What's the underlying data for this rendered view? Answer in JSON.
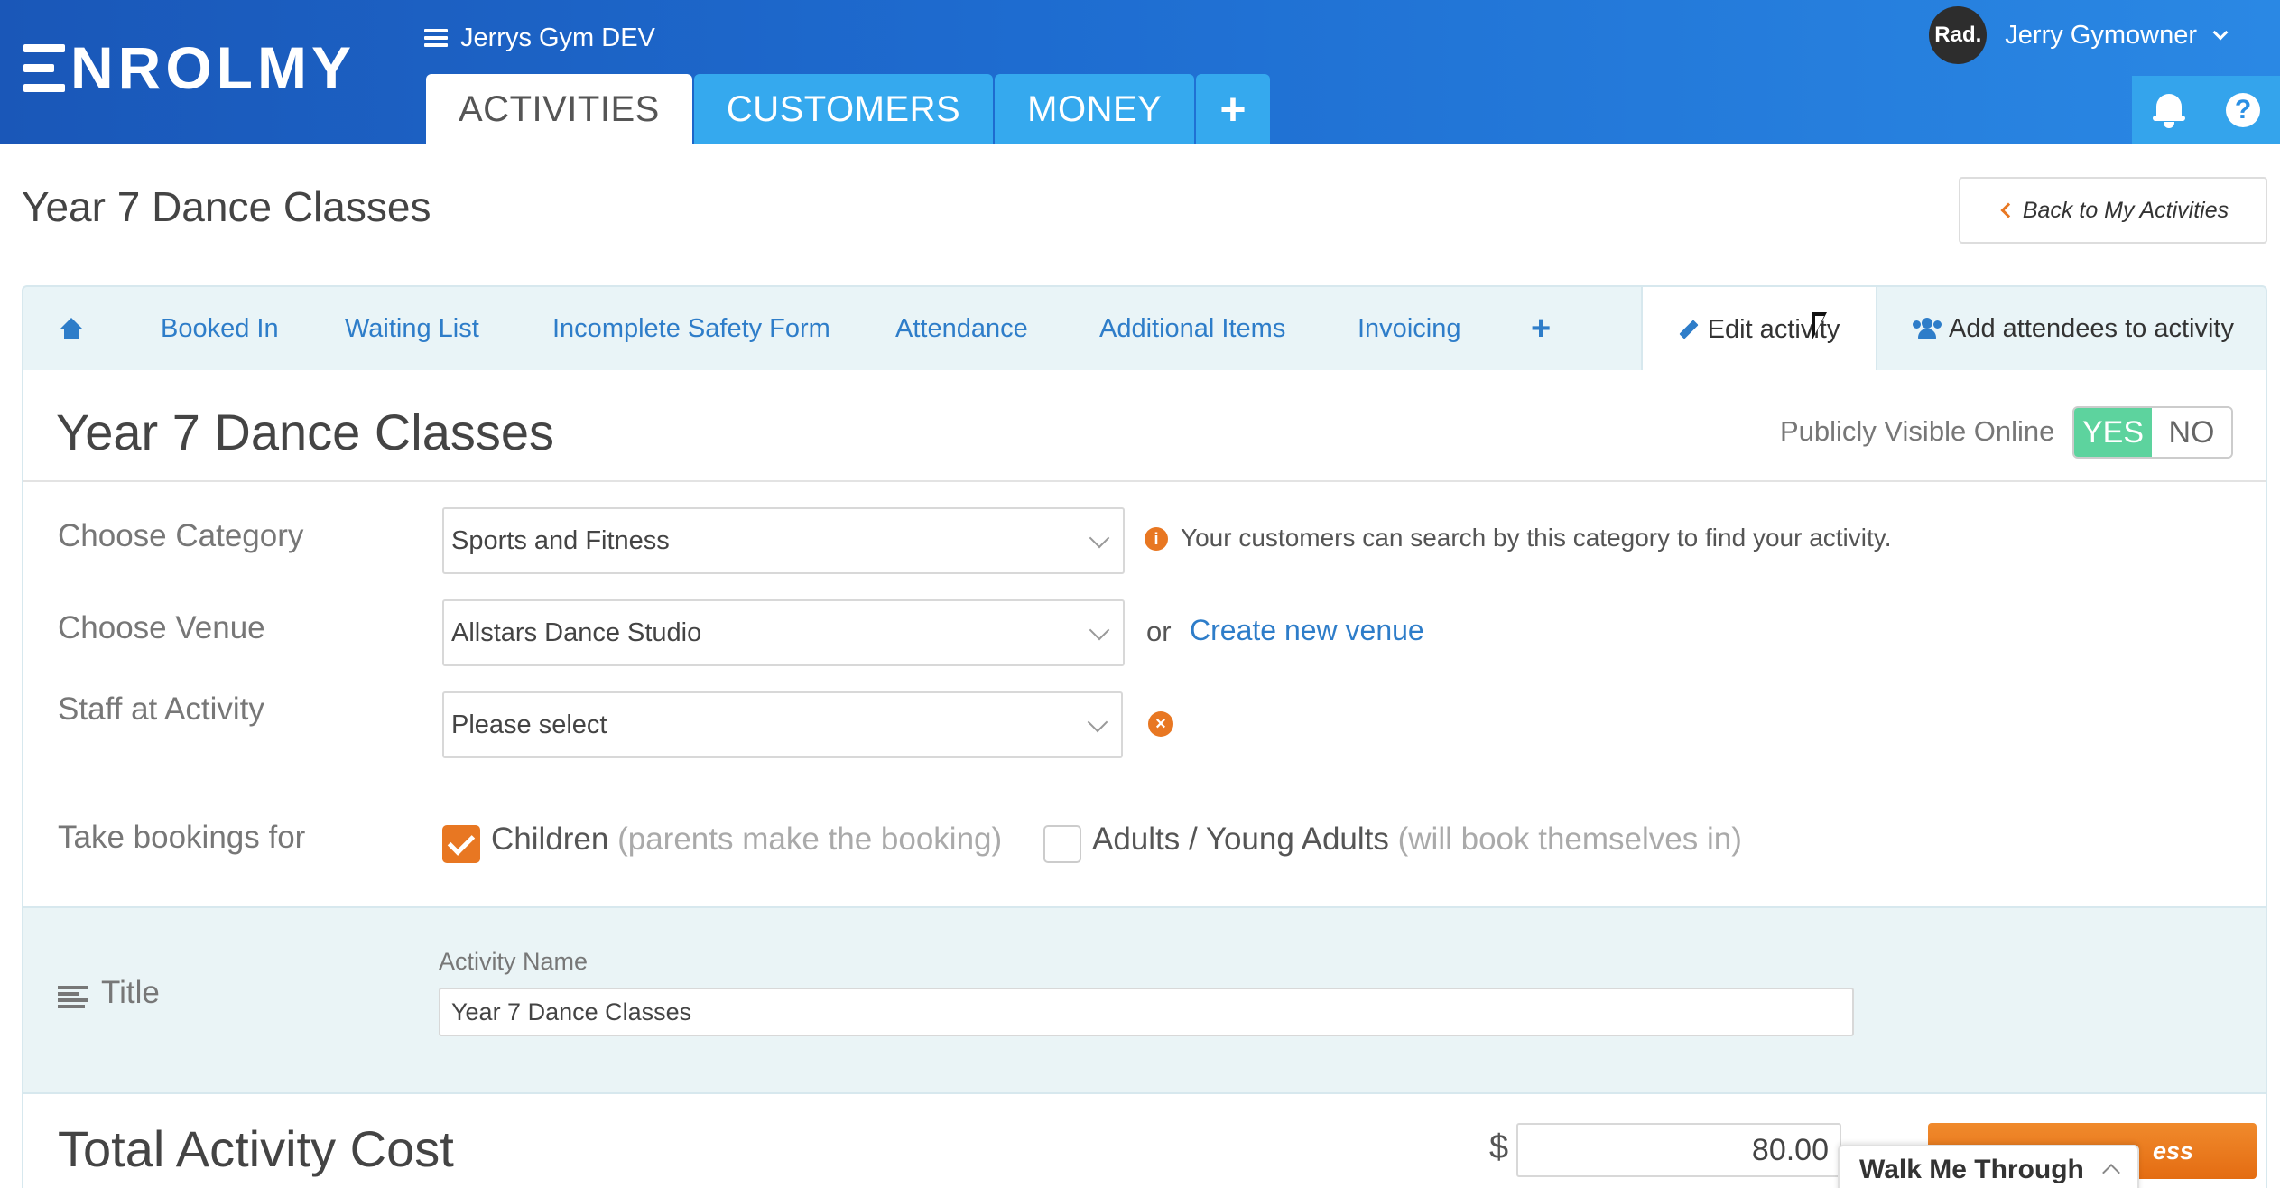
{
  "header": {
    "logo_text": "NROLMY",
    "org_name": "Jerrys Gym DEV",
    "main_tabs": [
      {
        "label": "ACTIVITIES",
        "active": true
      },
      {
        "label": "CUSTOMERS",
        "active": false
      },
      {
        "label": "MONEY",
        "active": false
      },
      {
        "label": "+",
        "active": false
      }
    ],
    "user": {
      "avatar_text": "Rad.",
      "name": "Jerry Gymowner"
    },
    "help_label": "?"
  },
  "page": {
    "title": "Year 7 Dance Classes",
    "back_button": "Back to My Activities"
  },
  "subtabs": [
    {
      "label": "Booked In"
    },
    {
      "label": "Waiting List"
    },
    {
      "label": "Incomplete Safety Form"
    },
    {
      "label": "Attendance"
    },
    {
      "label": "Additional Items"
    },
    {
      "label": "Invoicing"
    },
    {
      "label": "+"
    },
    {
      "label": "Edit activity",
      "active": true
    },
    {
      "label": "Add attendees to activity"
    }
  ],
  "form": {
    "heading": "Year 7 Dance Classes",
    "public_label": "Publicly Visible Online",
    "public_yes": "YES",
    "public_no": "NO",
    "public_value": "YES",
    "category_label": "Choose Category",
    "category_value": "Sports and Fitness",
    "category_hint": "Your customers can search by this category to find your activity.",
    "venue_label": "Choose Venue",
    "venue_value": "Allstars Dance Studio",
    "venue_or": "or",
    "venue_link": "Create new venue",
    "staff_label": "Staff at Activity",
    "staff_value": "Please select",
    "bookings_label": "Take bookings for",
    "opt_children": "Children",
    "opt_children_sub": "(parents make the booking)",
    "opt_children_checked": true,
    "opt_adults": "Adults / Young Adults",
    "opt_adults_sub": "(will book themselves in)",
    "opt_adults_checked": false,
    "title_section_label": "Title",
    "activity_name_label": "Activity Name",
    "activity_name_value": "Year 7 Dance Classes",
    "cost_label": "Total Activity Cost",
    "currency": "$",
    "cost_value": "80.00",
    "save_label": "ess"
  },
  "walkme_label": "Walk Me Through",
  "colors": {
    "header_start": "#1a57b8",
    "header_end": "#2a88e4",
    "tab_blue": "#35a9ee",
    "link_blue": "#2e7dc9",
    "accent_orange": "#e87722",
    "toggle_green": "#5dd39e"
  }
}
